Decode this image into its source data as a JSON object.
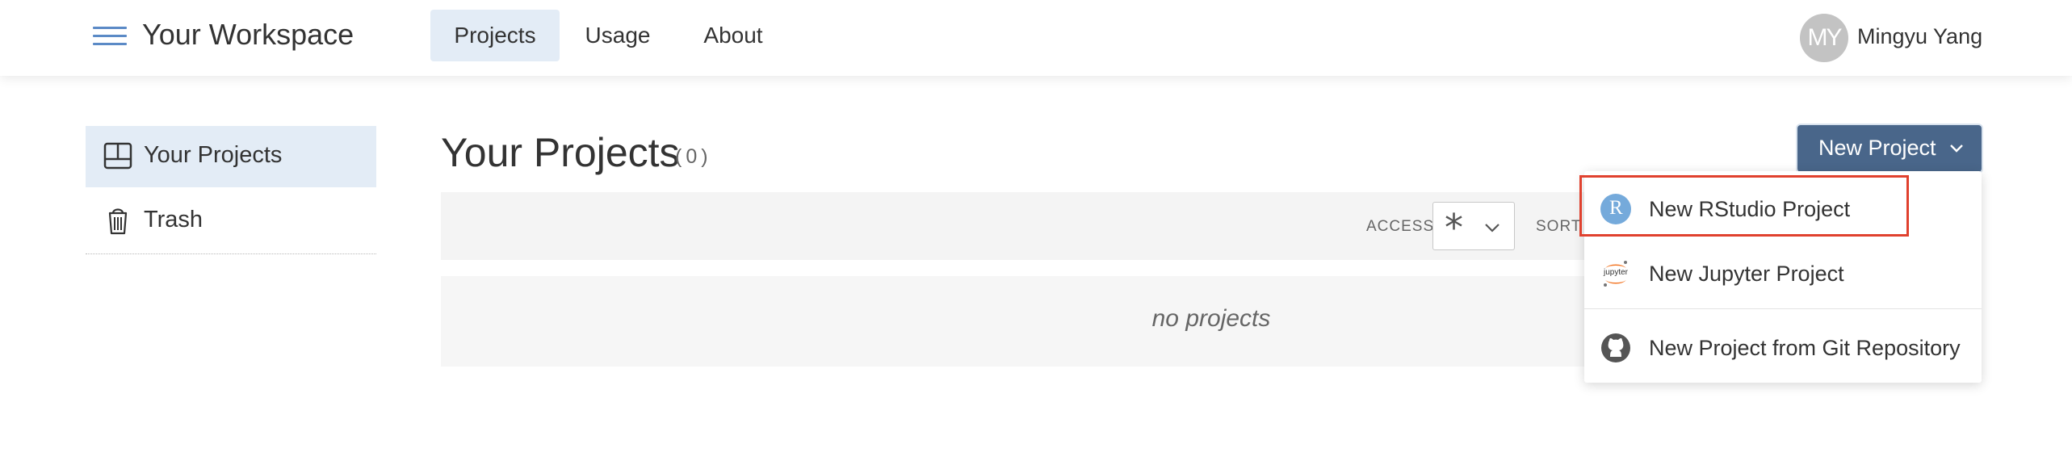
{
  "navbar": {
    "app_title": "Your Workspace",
    "tabs": [
      {
        "label": "Projects",
        "active": true
      },
      {
        "label": "Usage",
        "active": false
      },
      {
        "label": "About",
        "active": false
      }
    ],
    "user": {
      "initials": "MY",
      "name": "Mingyu Yang"
    }
  },
  "sidebar": {
    "items": [
      {
        "label": "Your Projects",
        "icon": "projects-grid-icon",
        "active": true
      },
      {
        "label": "Trash",
        "icon": "trash-icon",
        "active": false
      }
    ]
  },
  "main": {
    "title": "Your Projects",
    "count": "(0)",
    "filter": {
      "access_label": "ACCESS",
      "access_value": "*",
      "sort_label": "SORT"
    },
    "empty_text": "no projects"
  },
  "new_project": {
    "button_label": "New Project",
    "menu": [
      {
        "label": "New RStudio Project",
        "icon": "rstudio-icon",
        "icon_text": "R",
        "highlighted": true
      },
      {
        "label": "New Jupyter Project",
        "icon": "jupyter-icon",
        "icon_text": "jupyter"
      },
      {
        "label": "New Project from Git Repository",
        "icon": "github-icon"
      }
    ]
  },
  "colors": {
    "accent_button": "#49668a",
    "active_tab_bg": "#e3ecf6",
    "highlight_border": "#e0412e",
    "jupyter_orange": "#f37726",
    "rstudio_blue": "#75aadb"
  }
}
